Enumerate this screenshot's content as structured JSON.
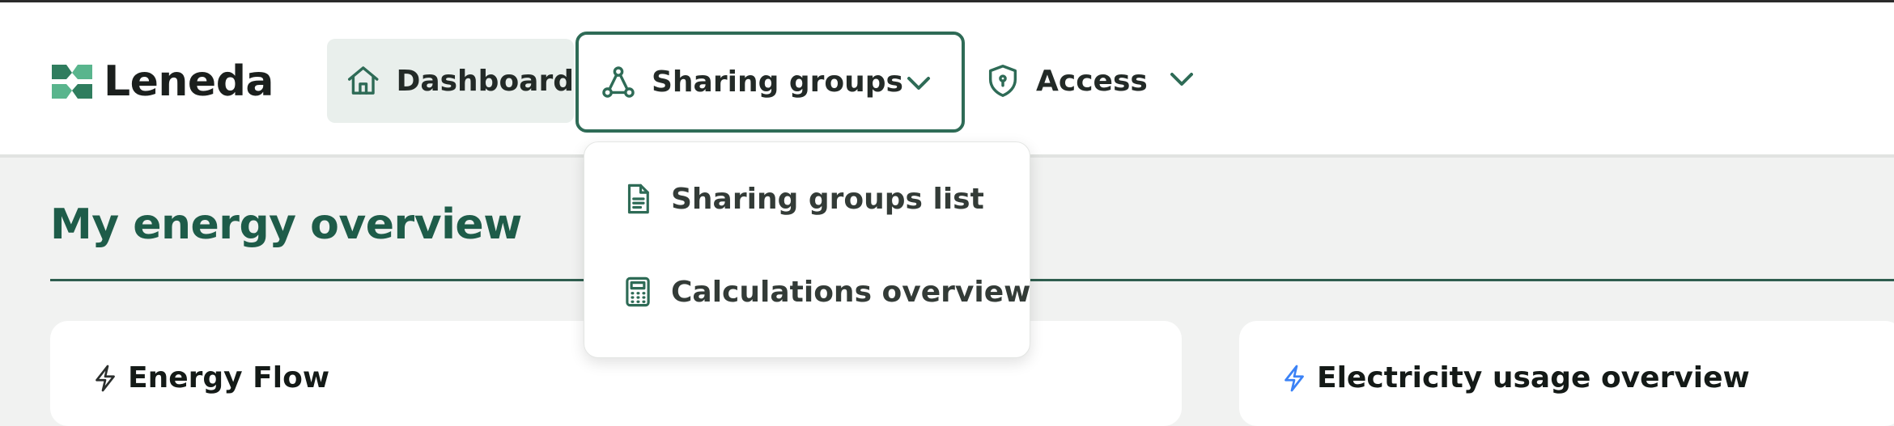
{
  "app": {
    "name": "Leneda"
  },
  "nav": {
    "dashboard": {
      "label": "Dashboard",
      "icon": "home-icon"
    },
    "sharing_groups": {
      "label": "Sharing groups",
      "icon": "share-nodes-icon",
      "expanded": true
    },
    "access": {
      "label": "Access",
      "icon": "shield-icon"
    }
  },
  "dropdown": {
    "items": [
      {
        "label": "Sharing groups list",
        "icon": "document-icon"
      },
      {
        "label": "Calculations overview",
        "icon": "calculator-icon"
      }
    ]
  },
  "page": {
    "title": "My energy overview"
  },
  "cards": [
    {
      "title": "Energy Flow",
      "icon": "lightning-icon"
    },
    {
      "title": "Electricity usage overview",
      "icon": "lightning-icon"
    }
  ],
  "colors": {
    "brand_green": "#2e6b56",
    "title_green": "#1e5c49",
    "accent_blue": "#3b82f6"
  }
}
